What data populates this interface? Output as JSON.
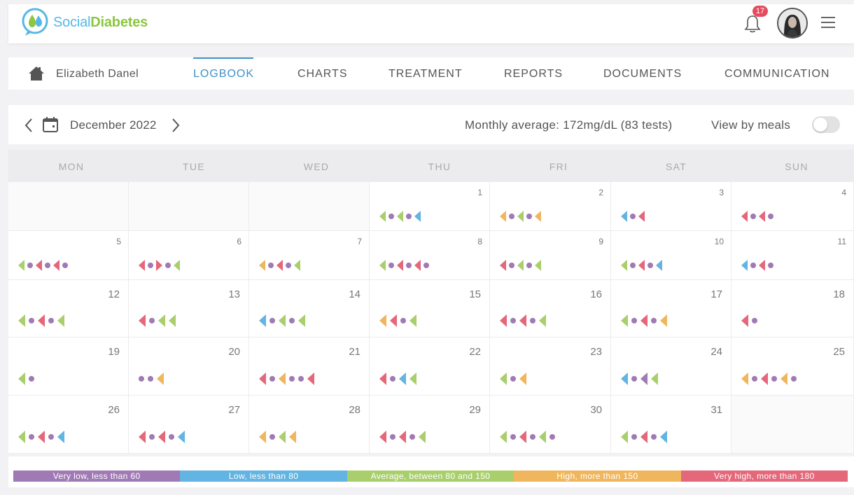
{
  "app": {
    "logo_part1": "Social",
    "logo_part2": "Diabetes",
    "notification_count": "17"
  },
  "nav": {
    "patient_name": "Elizabeth Danel",
    "tabs": [
      "LOGBOOK",
      "CHARTS",
      "TREATMENT",
      "REPORTS",
      "DOCUMENTS",
      "COMMUNICATION"
    ],
    "active_tab": "LOGBOOK"
  },
  "calendar": {
    "month_label": "December 2022",
    "monthly_average": "Monthly average: 172mg/dL (83 tests)",
    "view_by_meals_label": "View by meals",
    "view_by_meals_on": false,
    "weekdays": [
      "MON",
      "TUE",
      "WED",
      "THU",
      "FRI",
      "SAT",
      "SUN"
    ],
    "weeks": [
      [
        null,
        null,
        null,
        {
          "day": "1",
          "marks": [
            "l:green",
            "dot:purple",
            "l:green",
            "dot:purple",
            "l:blue"
          ]
        },
        {
          "day": "2",
          "marks": [
            "l:orange",
            "dot:purple",
            "l:green",
            "dot:purple",
            "l:orange"
          ]
        },
        {
          "day": "3",
          "marks": [
            "l:blue",
            "dot:purple",
            "l:red"
          ]
        },
        {
          "day": "4",
          "marks": [
            "l:red",
            "dot:purple",
            "l:red",
            "dot:purple"
          ]
        }
      ],
      [
        {
          "day": "5",
          "marks": [
            "l:green",
            "dot:purple",
            "l:red",
            "dot:purple",
            "l:red",
            "dot:purple"
          ]
        },
        {
          "day": "6",
          "marks": [
            "l:red",
            "dot:purple",
            "r:red",
            "dot:purple",
            "l:green"
          ]
        },
        {
          "day": "7",
          "marks": [
            "l:orange",
            "dot:purple",
            "l:red",
            "dot:purple",
            "l:green"
          ]
        },
        {
          "day": "8",
          "marks": [
            "l:green",
            "dot:purple",
            "l:red",
            "dot:purple",
            "l:red",
            "dot:purple"
          ]
        },
        {
          "day": "9",
          "marks": [
            "l:red",
            "dot:purple",
            "l:green",
            "dot:purple",
            "l:green"
          ]
        },
        {
          "day": "10",
          "marks": [
            "l:green",
            "dot:purple",
            "l:red",
            "dot:purple",
            "l:blue"
          ]
        },
        {
          "day": "11",
          "marks": [
            "l:blue",
            "dot:purple",
            "l:red",
            "dot:purple"
          ]
        }
      ],
      [
        {
          "day": "12",
          "marks": [
            "l:green",
            "dot:purple",
            "l:red",
            "dot:purple",
            "l:green"
          ]
        },
        {
          "day": "13",
          "marks": [
            "l:red",
            "dot:purple",
            "l:green",
            "l:green"
          ]
        },
        {
          "day": "14",
          "marks": [
            "l:blue",
            "dot:purple",
            "l:green",
            "dot:purple",
            "l:green"
          ]
        },
        {
          "day": "15",
          "marks": [
            "l:orange",
            "l:red",
            "dot:purple",
            "l:green"
          ]
        },
        {
          "day": "16",
          "marks": [
            "l:red",
            "dot:purple",
            "l:red",
            "dot:purple",
            "l:green"
          ]
        },
        {
          "day": "17",
          "marks": [
            "l:green",
            "dot:purple",
            "l:red",
            "dot:purple",
            "l:orange"
          ]
        },
        {
          "day": "18",
          "marks": [
            "l:red",
            "dot:purple"
          ]
        }
      ],
      [
        {
          "day": "19",
          "marks": [
            "l:green",
            "dot:purple"
          ]
        },
        {
          "day": "20",
          "marks": [
            "dot:purple",
            "dot:purple",
            "l:orange"
          ]
        },
        {
          "day": "21",
          "marks": [
            "l:red",
            "dot:purple",
            "l:orange",
            "dot:purple",
            "dot:purple",
            "l:red"
          ]
        },
        {
          "day": "22",
          "marks": [
            "l:red",
            "dot:purple",
            "l:blue",
            "l:green"
          ]
        },
        {
          "day": "23",
          "marks": [
            "l:green",
            "dot:purple",
            "l:orange"
          ]
        },
        {
          "day": "24",
          "marks": [
            "l:blue",
            "dot:purple",
            "l:purple",
            "l:green"
          ]
        },
        {
          "day": "25",
          "marks": [
            "l:orange",
            "dot:purple",
            "l:red",
            "dot:purple",
            "l:orange",
            "dot:purple"
          ]
        }
      ],
      [
        {
          "day": "26",
          "marks": [
            "l:green",
            "dot:purple",
            "l:red",
            "dot:purple",
            "l:blue"
          ]
        },
        {
          "day": "27",
          "marks": [
            "l:red",
            "dot:purple",
            "l:red",
            "dot:purple",
            "l:blue"
          ]
        },
        {
          "day": "28",
          "marks": [
            "l:orange",
            "dot:purple",
            "l:green",
            "l:orange"
          ]
        },
        {
          "day": "29",
          "marks": [
            "l:red",
            "dot:purple",
            "l:red",
            "dot:purple",
            "l:green"
          ]
        },
        {
          "day": "30",
          "marks": [
            "l:green",
            "dot:purple",
            "l:red",
            "dot:purple",
            "l:green",
            "dot:purple"
          ]
        },
        {
          "day": "31",
          "marks": [
            "l:green",
            "dot:purple",
            "l:red",
            "dot:purple",
            "l:blue"
          ]
        },
        null
      ]
    ]
  },
  "legend": [
    {
      "label": "Very low, less than 60",
      "color": "#a07ab4"
    },
    {
      "label": "Low, less than 80",
      "color": "#62b4e2"
    },
    {
      "label": "Average, between 80 and 150",
      "color": "#a9cf6c"
    },
    {
      "label": "High, more than 150",
      "color": "#f0b65e"
    },
    {
      "label": "Very high, more than 180",
      "color": "#e5677a"
    }
  ],
  "colors": {
    "purple": "#a07ab4",
    "blue": "#62b4e2",
    "green": "#a9cf6c",
    "orange": "#f0b65e",
    "red": "#e5677a",
    "accent": "#3f92c8"
  }
}
